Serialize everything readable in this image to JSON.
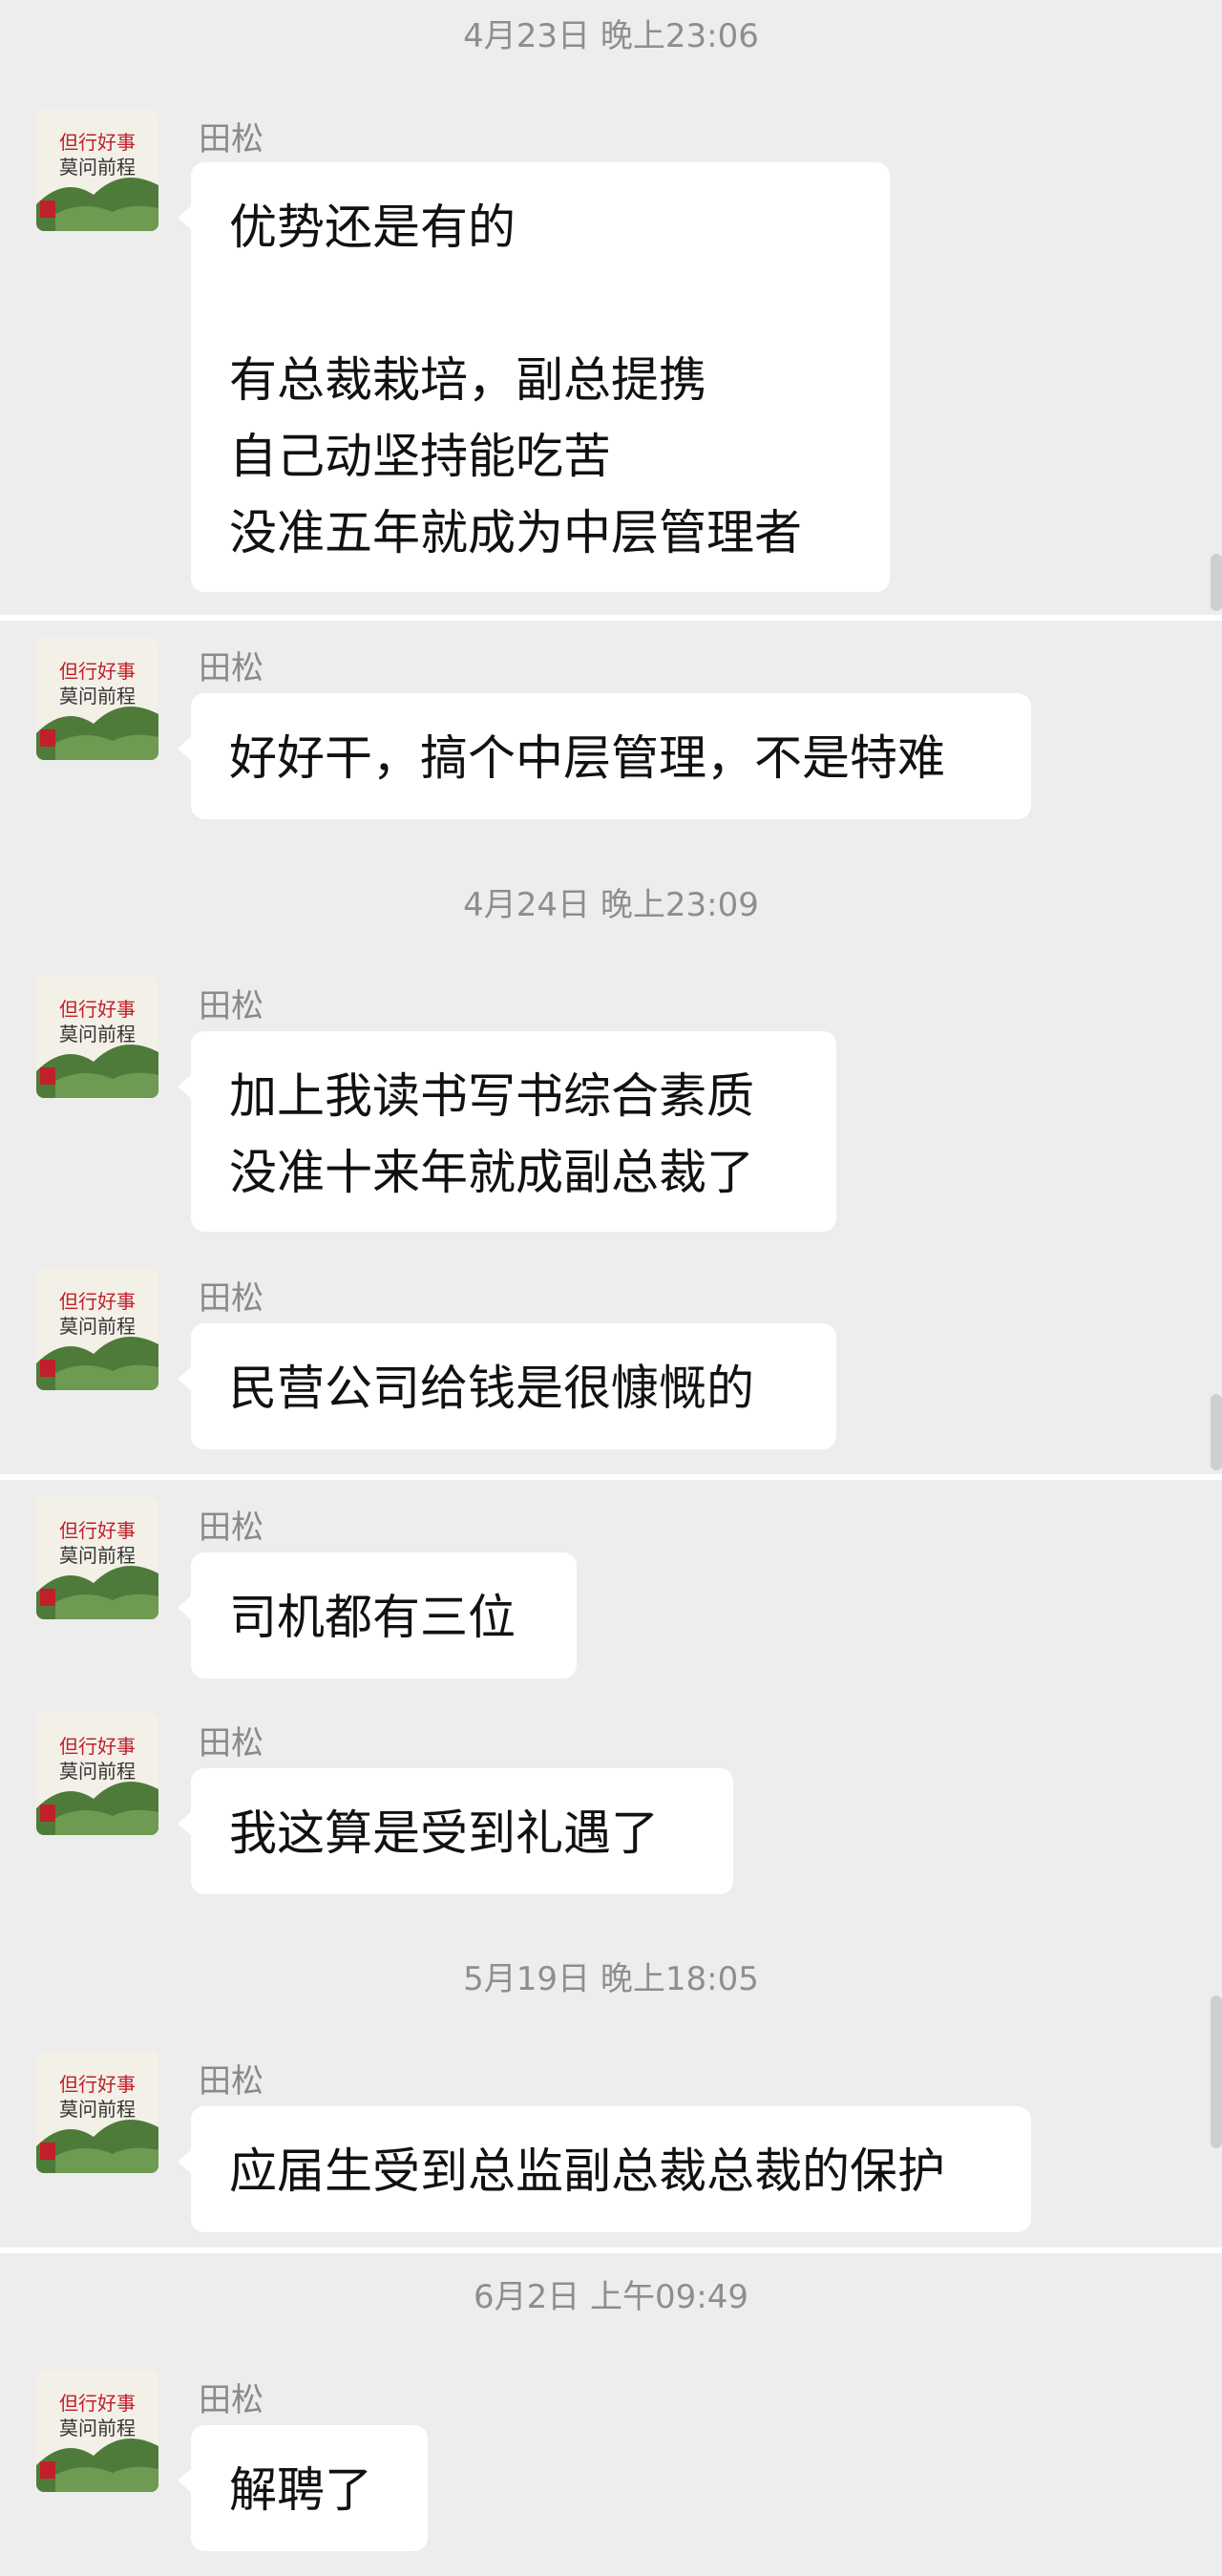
{
  "contact_name": "田松",
  "avatar_text": {
    "top": "但行好事",
    "bottom": "莫问前程"
  },
  "timestamps": [
    "4月23日 晚上23:06",
    "4月24日 晚上23:09",
    "5月19日 晚上18:05",
    "6月2日 上午09:49"
  ],
  "messages": [
    "优势还是有的\n\n有总裁栽培，副总提携\n自己动坚持能吃苦\n没准五年就成为中层管理者",
    "好好干，搞个中层管理，不是特难",
    "加上我读书写书综合素质\n没准十来年就成副总裁了",
    "民营公司给钱是很慷慨的",
    "司机都有三位",
    "我这算是受到礼遇了",
    "应届生受到总监副总裁总裁的保护",
    "解聘了"
  ],
  "colors": {
    "background": "#ededed",
    "bubble": "#ffffff",
    "timestamp": "#8e8e8e",
    "avatar_text_red": "#c0202a",
    "avatar_mountain": "#4f7b3a"
  }
}
